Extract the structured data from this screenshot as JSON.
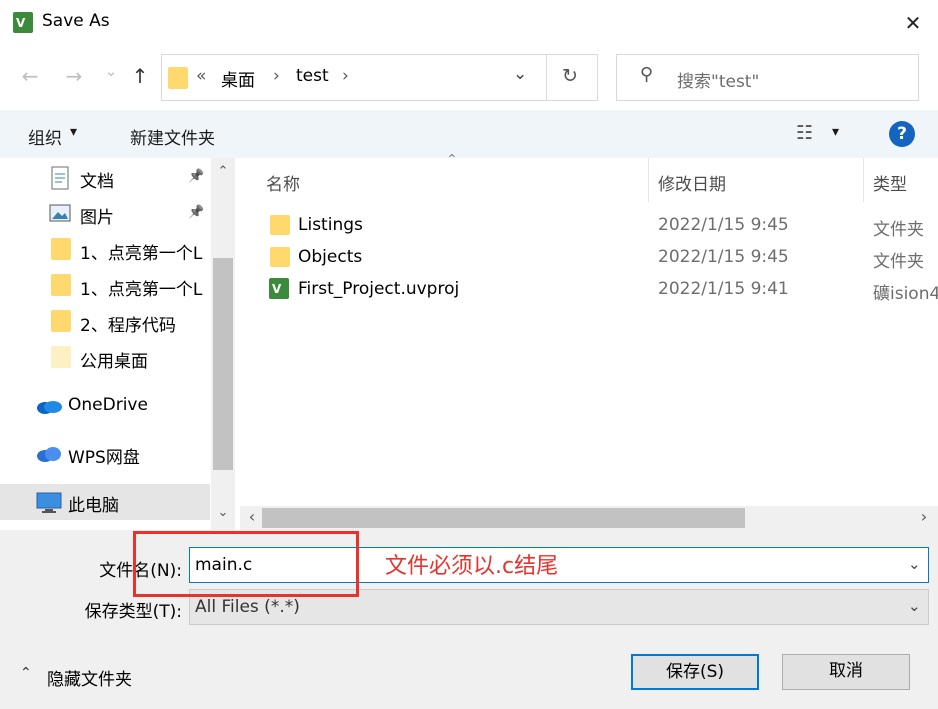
{
  "window": {
    "title": "Save As",
    "close_glyph": "✕"
  },
  "nav": {
    "back_glyph": "←",
    "forward_glyph": "→",
    "recent_glyph": "⌄",
    "up_glyph": "↑",
    "breadcrumb_prefix": "«",
    "breadcrumb": [
      "桌面",
      "test"
    ],
    "breadcrumb_sep": "›",
    "dropdown_glyph": "⌄",
    "refresh_glyph": "↻",
    "search_placeholder": "搜索\"test\"",
    "search_glyph": "⚲"
  },
  "toolbar": {
    "organize_label": "组织",
    "organize_arrow": "▾",
    "new_folder_label": "新建文件夹",
    "view_glyph": "☷",
    "view_arrow": "▾",
    "help_label": "?"
  },
  "sidebar": {
    "items": [
      {
        "label": "文档",
        "icon": "document-icon",
        "pinned": true
      },
      {
        "label": "图片",
        "icon": "picture-icon",
        "pinned": true
      },
      {
        "label": "1、点亮第一个L",
        "icon": "folder-icon"
      },
      {
        "label": "1、点亮第一个L",
        "icon": "folder-icon"
      },
      {
        "label": "2、程序代码",
        "icon": "folder-icon"
      },
      {
        "label": "公用桌面",
        "icon": "folder-icon"
      },
      {
        "label": "OneDrive",
        "icon": "onedrive-icon"
      },
      {
        "label": "WPS网盘",
        "icon": "wps-cloud-icon"
      },
      {
        "label": "此电脑",
        "icon": "computer-icon",
        "selected": true
      }
    ],
    "pin_glyph": "📌",
    "scroll_up": "⌃",
    "scroll_down": "⌄"
  },
  "files": {
    "columns": [
      "名称",
      "修改日期",
      "类型"
    ],
    "sort_glyph": "⌃",
    "rows": [
      {
        "name": "Listings",
        "date": "2022/1/15 9:45",
        "type": "文件夹",
        "icon": "folder-icon"
      },
      {
        "name": "Objects",
        "date": "2022/1/15 9:45",
        "type": "文件夹",
        "icon": "folder-icon"
      },
      {
        "name": "First_Project.uvproj",
        "date": "2022/1/15 9:41",
        "type": "礦ision4",
        "icon": "keil-project-icon"
      }
    ],
    "scroll_left": "‹",
    "scroll_right": "›"
  },
  "form": {
    "filename_label": "文件名(N):",
    "filename_value": "main.c",
    "filetype_label": "保存类型(T):",
    "filetype_value": "All Files (*.*)",
    "dropdown_glyph": "⌄",
    "annotation_text": "文件必须以.c结尾"
  },
  "footer": {
    "hide_folders_glyph": "⌃",
    "hide_folders_label": "隐藏文件夹",
    "save_label": "保存(S)",
    "cancel_label": "取消"
  },
  "colors": {
    "accent": "#0078d7",
    "annotation": "#e8332c",
    "folder": "#ffd86e"
  }
}
